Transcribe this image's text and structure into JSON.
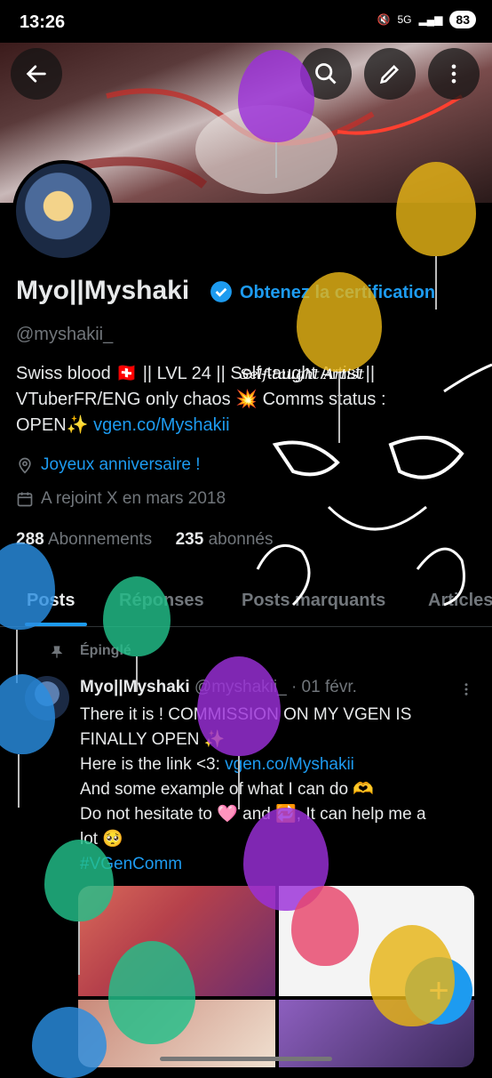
{
  "status_bar": {
    "time": "13:26",
    "network": "5G",
    "battery": "83"
  },
  "profile": {
    "name": "Myo||Myshaki",
    "cert_label": "Obtenez la certification",
    "handle": "@myshakii_",
    "bio_line1": "Swiss blood 🇨🇭 || LVL 24 || Self-taught Artist ||",
    "bio_line2": "VTuberFR/ENG only chaos 💥 Comms status :",
    "bio_line3_prefix": "OPEN✨ ",
    "bio_link": "vgen.co/Myshakii",
    "birthday": "Joyeux anniversaire !",
    "joined": "A rejoint X en mars 2018",
    "following_count": "288",
    "following_label": "Abonnements",
    "followers_count": "235",
    "followers_label": "abonnés",
    "scribble_text": "Self-taught Artist"
  },
  "tabs": [
    "Posts",
    "Réponses",
    "Posts marquants",
    "Articles"
  ],
  "pinned_label": "Épinglé",
  "post": {
    "author": "Myo||Myshaki",
    "handle": "@myshakii_",
    "date": "· 01 févr.",
    "line1": "There it is ! COMMISSION ON MY VGEN IS",
    "line2": "FINALLY OPEN ✨",
    "line3_prefix": "Here is the link <3: ",
    "line3_link": "vgen.co/Myshakii",
    "line4": "And some example of what I can do 🫶",
    "line5": "Do not hesitate to 🩷 and 🔁, It can help me a",
    "line6": "lot 🥺",
    "hashtag": "#VGenComm"
  },
  "fab_label": "+",
  "colors": {
    "accent": "#1d9bf0",
    "background": "#000000",
    "muted": "#71767b"
  },
  "icons": [
    "back-arrow-icon",
    "search-icon",
    "edit-icon",
    "more-icon",
    "verified-icon",
    "location-icon",
    "calendar-icon",
    "pin-icon",
    "more-post-icon",
    "compose-icon"
  ]
}
